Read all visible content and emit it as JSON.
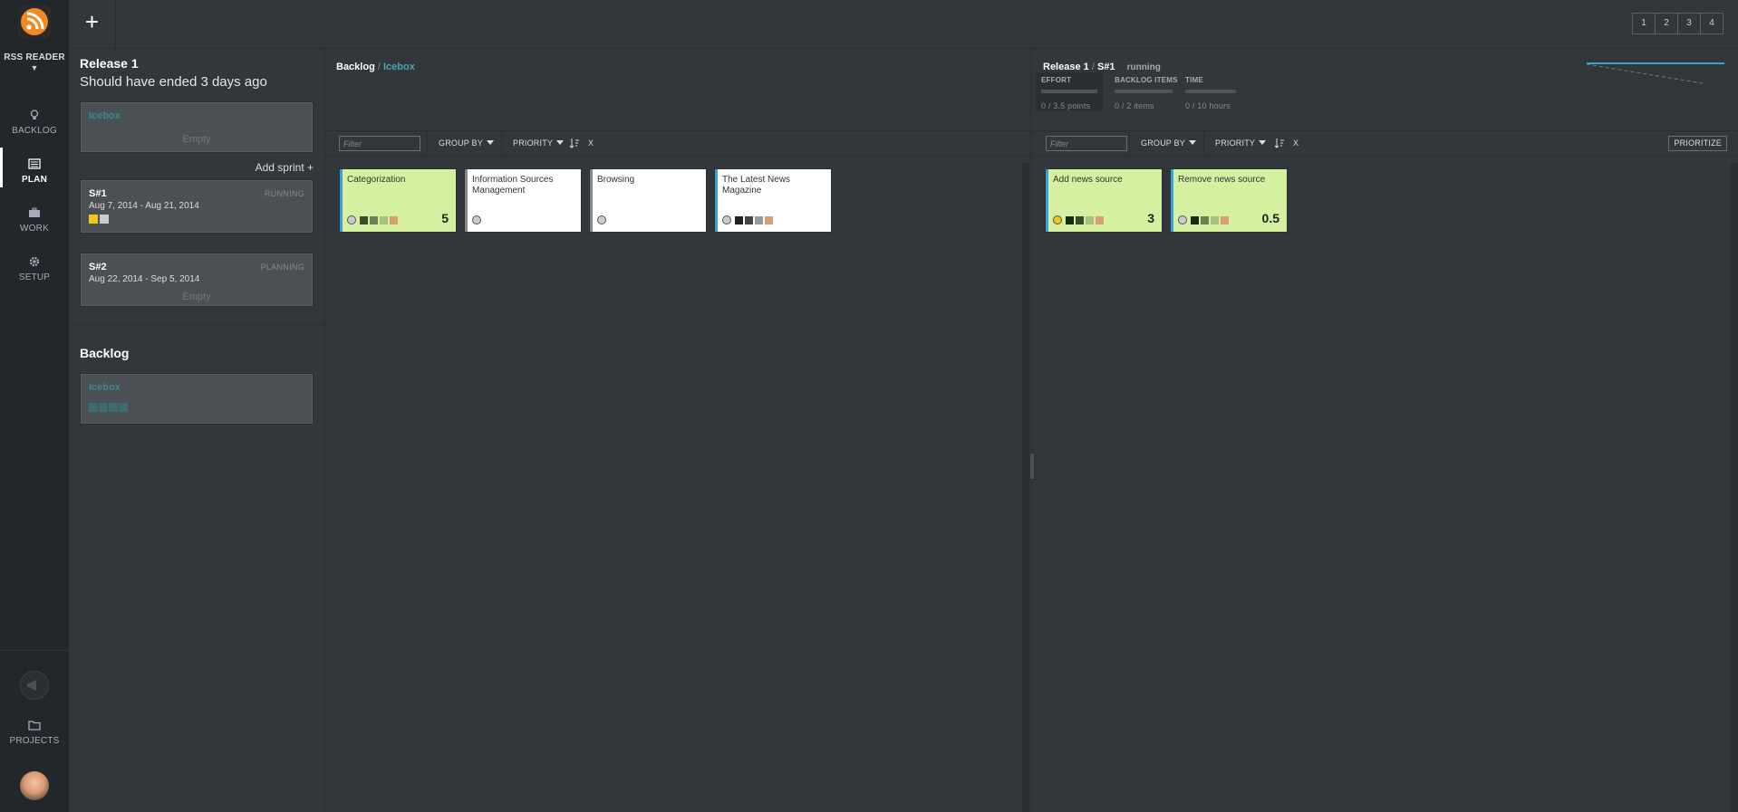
{
  "rail": {
    "project_name": "RSS READER",
    "nav": [
      {
        "label": "BACKLOG",
        "icon": "lightbulb-icon"
      },
      {
        "label": "PLAN",
        "icon": "list-icon"
      },
      {
        "label": "WORK",
        "icon": "briefcase-icon"
      },
      {
        "label": "SETUP",
        "icon": "gear-icon"
      }
    ],
    "projects_label": "PROJECTS",
    "active": "PLAN"
  },
  "topbar": {
    "add_label": "+",
    "view_buttons": [
      "1",
      "2",
      "3",
      "4"
    ]
  },
  "release": {
    "title": "Release 1",
    "subtitle": "Should have ended 3 days ago",
    "icebox": {
      "name": "Icebox",
      "empty": "Empty"
    },
    "add_sprint": "Add sprint +",
    "sprints": [
      {
        "name": "S#1",
        "dates": "Aug 7, 2014 - Aug 21, 2014",
        "status": "RUNNING",
        "chips": [
          "#f5c518",
          "#c8ccd0"
        ]
      },
      {
        "name": "S#2",
        "dates": "Aug 22, 2014 - Sep 5, 2014",
        "status": "PLANNING",
        "empty": "Empty"
      }
    ],
    "backlog_heading": "Backlog",
    "backlog_icebox": {
      "name": "Icebox"
    }
  },
  "left_panel": {
    "crumb_root": "Backlog",
    "crumb_sep": "/",
    "crumb_leaf": "Icebox",
    "filter_placeholder": "Filter",
    "group_by": "GROUP BY",
    "priority": "PRIORITY",
    "clear": "X",
    "cards": [
      {
        "title": "Categorization",
        "points": "5",
        "bg": "#d4f0a0",
        "bar": "#3aa0d8",
        "circle": "#c8ccd0",
        "chips": [
          "#3a4a2a",
          "#6a8050",
          "#a8c080",
          "#d8a070"
        ]
      },
      {
        "title": "Information Sources Management",
        "points": "",
        "bg": "#ffffff",
        "bar": "#888888",
        "circle": "#c8ccd0",
        "chips": []
      },
      {
        "title": "Browsing",
        "points": "",
        "bg": "#ffffff",
        "bar": "#888888",
        "circle": "#c8ccd0",
        "chips": []
      },
      {
        "title": "The Latest News Magazine",
        "points": "",
        "bg": "#ffffff",
        "bar": "#3aa0d8",
        "circle": "#c8ccd0",
        "chips": [
          "#222222",
          "#444444",
          "#999999",
          "#d8a070"
        ]
      }
    ]
  },
  "right_panel": {
    "release": "Release 1",
    "sep": "/",
    "sprint": "S#1",
    "state": "running",
    "stats": [
      {
        "label": "EFFORT",
        "value": "0 / 3.5 points"
      },
      {
        "label": "BACKLOG ITEMS",
        "value": "0 / 2 items"
      },
      {
        "label": "TIME",
        "value": "0 / 10 hours"
      }
    ],
    "filter_placeholder": "Filter",
    "group_by": "GROUP BY",
    "priority": "PRIORITY",
    "clear": "X",
    "prioritize": "PRIORITIZE",
    "cards": [
      {
        "title": "Add news source",
        "points": "3",
        "bg": "#d4f0a0",
        "bar": "#3aa0d8",
        "circle": "#f5c518",
        "chips": [
          "#1a2a10",
          "#3a4a2a",
          "#a8c080",
          "#d8a070"
        ]
      },
      {
        "title": "Remove news source",
        "points": "0.5",
        "bg": "#d4f0a0",
        "bar": "#3aa0d8",
        "circle": "#c8ccd0",
        "chips": [
          "#1a2a10",
          "#6a8050",
          "#a8c080",
          "#d8a070"
        ]
      }
    ]
  },
  "colors": {
    "accent": "#3aa0d8",
    "icebox": "#46a6b3",
    "card_green": "#d4f0a0"
  }
}
